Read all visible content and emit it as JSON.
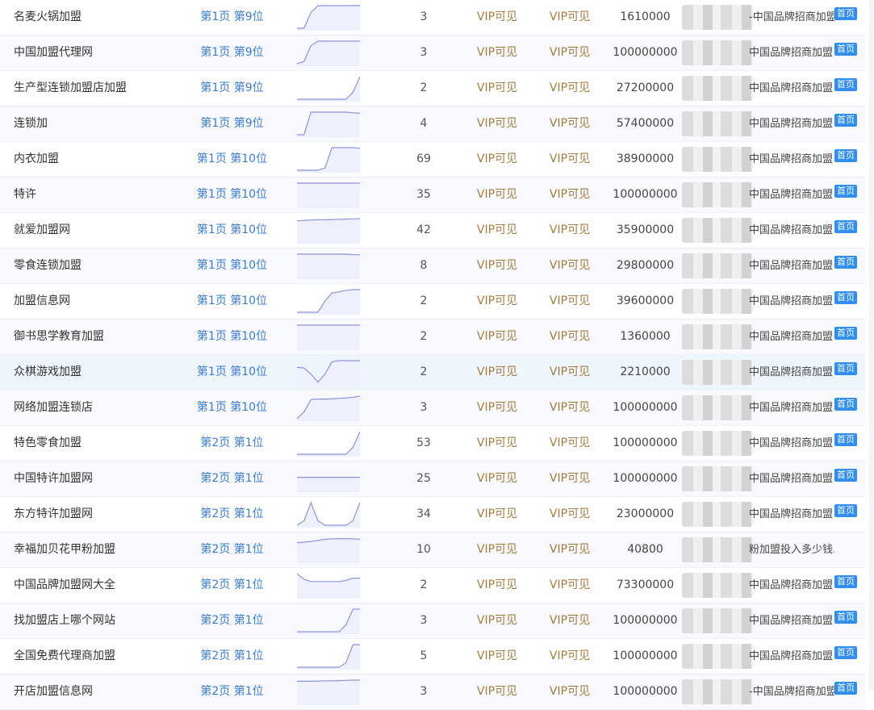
{
  "colors": {
    "rank_link": "#3a7bd5",
    "vip": "#a57a3b",
    "badge": "#2f8ef0",
    "trend_line": "#8d93d9",
    "trend_fill": "#eef0fb"
  },
  "rows": [
    {
      "keyword": "名麦火锅加盟",
      "rank": "第1页 第9位",
      "trend": [
        0,
        0,
        0.7,
        1,
        1,
        1,
        1,
        1,
        1,
        1
      ],
      "index": "3",
      "vip1": "VIP可见",
      "vip2": "VIP可见",
      "number": "1610000",
      "title": "-中国品牌招商加盟",
      "badge": "首页"
    },
    {
      "keyword": "中国加盟代理网",
      "rank": "第1页 第9位",
      "trend": [
        0,
        0.1,
        0.8,
        1,
        1,
        1,
        1,
        1,
        1,
        1
      ],
      "index": "3",
      "vip1": "VIP可见",
      "vip2": "VIP可见",
      "number": "100000000",
      "title": "中国品牌招商加盟",
      "badge": "首页"
    },
    {
      "keyword": "生产型连锁加盟店加盟",
      "rank": "第1页 第9位",
      "trend": [
        0,
        0,
        0,
        0,
        0,
        0,
        0,
        0,
        0.3,
        1
      ],
      "index": "2",
      "vip1": "VIP可见",
      "vip2": "VIP可见",
      "number": "27200000",
      "title": "中国品牌招商加盟",
      "badge": "首页"
    },
    {
      "keyword": "连锁加",
      "rank": "第1页 第9位",
      "trend": [
        0,
        0,
        1,
        1,
        1,
        1,
        1,
        1,
        0.97,
        0.95
      ],
      "index": "4",
      "vip1": "VIP可见",
      "vip2": "VIP可见",
      "number": "57400000",
      "title": "中国品牌招商加盟",
      "badge": "首页"
    },
    {
      "keyword": "内衣加盟",
      "rank": "第1页 第10位",
      "trend": [
        0,
        0,
        0,
        0,
        0.1,
        1,
        1,
        1,
        1,
        0.97
      ],
      "index": "69",
      "vip1": "VIP可见",
      "vip2": "VIP可见",
      "number": "38900000",
      "title": "中国品牌招商加盟",
      "badge": "首页"
    },
    {
      "keyword": "特许",
      "rank": "第1页 第10位",
      "trend": [
        1,
        1,
        1,
        1,
        1,
        1,
        1,
        1,
        1,
        1
      ],
      "index": "35",
      "vip1": "VIP可见",
      "vip2": "VIP可见",
      "number": "100000000",
      "title": "中国品牌招商加盟",
      "badge": "首页"
    },
    {
      "keyword": "就爱加盟网",
      "rank": "第1页 第10位",
      "trend": [
        0.9,
        0.92,
        0.94,
        0.95,
        0.95,
        0.96,
        0.97,
        0.98,
        0.99,
        1
      ],
      "index": "42",
      "vip1": "VIP可见",
      "vip2": "VIP可见",
      "number": "35900000",
      "title": "中国品牌招商加盟",
      "badge": "首页"
    },
    {
      "keyword": "零食连锁加盟",
      "rank": "第1页 第10位",
      "trend": [
        1,
        1,
        1,
        1,
        1,
        1,
        1,
        1,
        0.98,
        0.97
      ],
      "index": "8",
      "vip1": "VIP可见",
      "vip2": "VIP可见",
      "number": "29800000",
      "title": "中国品牌招商加盟",
      "badge": "首页"
    },
    {
      "keyword": "加盟信息网",
      "rank": "第1页 第10位",
      "trend": [
        0,
        0,
        0,
        0,
        0.5,
        0.85,
        0.9,
        0.97,
        1,
        1
      ],
      "index": "2",
      "vip1": "VIP可见",
      "vip2": "VIP可见",
      "number": "39600000",
      "title": "中国品牌招商加盟",
      "badge": "首页"
    },
    {
      "keyword": "御书思学教育加盟",
      "rank": "第1页 第10位",
      "trend": [
        1,
        1,
        1,
        1,
        1,
        1,
        1,
        1,
        1,
        1
      ],
      "index": "2",
      "vip1": "VIP可见",
      "vip2": "VIP可见",
      "number": "1360000",
      "title": "中国品牌招商加盟",
      "badge": "首页"
    },
    {
      "keyword": "众棋游戏加盟",
      "rank": "第1页 第10位",
      "trend": [
        0.7,
        0.68,
        0.4,
        0.05,
        0.4,
        0.95,
        1,
        1,
        1,
        1
      ],
      "index": "2",
      "vip1": "VIP可见",
      "vip2": "VIP可见",
      "number": "2210000",
      "title": "中国品牌招商加盟",
      "badge": "首页"
    },
    {
      "keyword": "网络加盟连锁店",
      "rank": "第1页 第10位",
      "trend": [
        0,
        0.3,
        0.85,
        0.87,
        0.87,
        0.88,
        0.9,
        0.92,
        0.95,
        1
      ],
      "index": "3",
      "vip1": "VIP可见",
      "vip2": "VIP可见",
      "number": "100000000",
      "title": "中国品牌招商加盟",
      "badge": "首页"
    },
    {
      "keyword": "特色零食加盟",
      "rank": "第2页 第1位",
      "trend": [
        0,
        0,
        0,
        0,
        0,
        0,
        0,
        0,
        0.3,
        1
      ],
      "index": "53",
      "vip1": "VIP可见",
      "vip2": "VIP可见",
      "number": "100000000",
      "title": "中国品牌招商加盟",
      "badge": "首页"
    },
    {
      "keyword": "中国特许加盟网",
      "rank": "第2页 第1位",
      "trend": [
        0.55,
        0.55,
        0.55,
        0.55,
        0.55,
        0.55,
        0.55,
        0.55,
        0.55,
        0.55
      ],
      "index": "25",
      "vip1": "VIP可见",
      "vip2": "VIP可见",
      "number": "100000000",
      "title": "中国品牌招商加盟",
      "badge": "首页"
    },
    {
      "keyword": "东方特许加盟网",
      "rank": "第2页 第1位",
      "trend": [
        0,
        0.2,
        1,
        0.2,
        0,
        0,
        0,
        0,
        0.2,
        1
      ],
      "index": "34",
      "vip1": "VIP可见",
      "vip2": "VIP可见",
      "number": "23000000",
      "title": "中国品牌招商加盟",
      "badge": "首页"
    },
    {
      "keyword": "幸福加贝花甲粉加盟",
      "rank": "第2页 第1位",
      "trend": [
        0.8,
        0.82,
        0.85,
        0.9,
        0.95,
        0.97,
        0.98,
        0.98,
        0.97,
        0.95
      ],
      "index": "10",
      "vip1": "VIP可见",
      "vip2": "VIP可见",
      "number": "40800",
      "title": "粉加盟投入多少钱…",
      "badge": ""
    },
    {
      "keyword": "中国品牌加盟网大全",
      "rank": "第2页 第1位",
      "trend": [
        1,
        0.75,
        0.65,
        0.65,
        0.65,
        0.65,
        0.65,
        0.7,
        0.8,
        0.8
      ],
      "index": "2",
      "vip1": "VIP可见",
      "vip2": "VIP可见",
      "number": "73300000",
      "title": "中国品牌招商加盟",
      "badge": "首页"
    },
    {
      "keyword": "找加盟店上哪个网站",
      "rank": "第2页 第1位",
      "trend": [
        0,
        0,
        0,
        0,
        0,
        0,
        0,
        0.3,
        1,
        1
      ],
      "index": "3",
      "vip1": "VIP可见",
      "vip2": "VIP可见",
      "number": "100000000",
      "title": "中国品牌招商加盟",
      "badge": "首页"
    },
    {
      "keyword": "全国免费代理商加盟",
      "rank": "第2页 第1位",
      "trend": [
        0,
        0,
        0,
        0,
        0,
        0,
        0,
        0.2,
        1,
        1
      ],
      "index": "5",
      "vip1": "VIP可见",
      "vip2": "VIP可见",
      "number": "100000000",
      "title": "中国品牌招商加盟",
      "badge": "首页"
    },
    {
      "keyword": "开店加盟信息网",
      "rank": "第2页 第1位",
      "trend": [
        0.95,
        0.95,
        0.95,
        0.96,
        0.97,
        0.97,
        0.98,
        0.99,
        1,
        1
      ],
      "index": "3",
      "vip1": "VIP可见",
      "vip2": "VIP可见",
      "number": "100000000",
      "title": "-中国品牌招商加盟",
      "badge": "首页"
    }
  ]
}
